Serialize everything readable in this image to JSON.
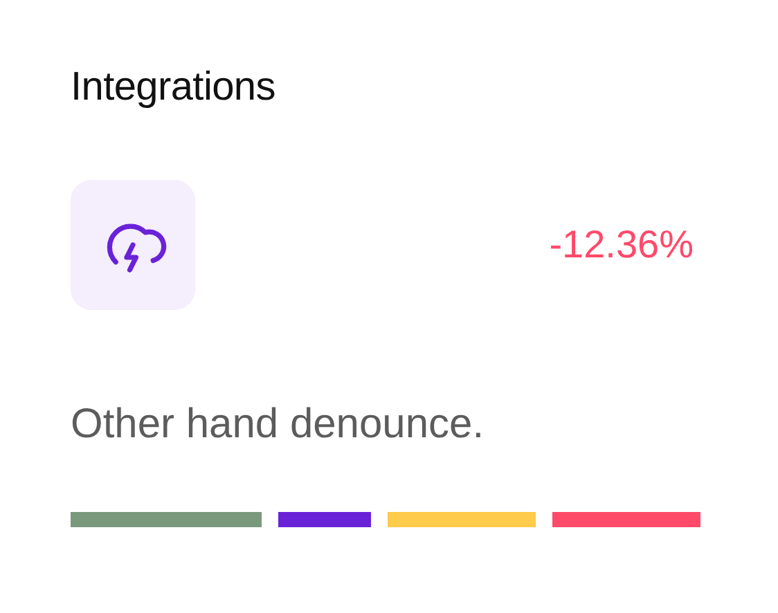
{
  "card": {
    "title": "Integrations",
    "change": "-12.36%",
    "description": "Other hand denounce.",
    "segments": [
      {
        "color": "#7a987c"
      },
      {
        "color": "#6a22d8"
      },
      {
        "color": "#fecb4a"
      },
      {
        "color": "#ff4a6a"
      }
    ]
  }
}
